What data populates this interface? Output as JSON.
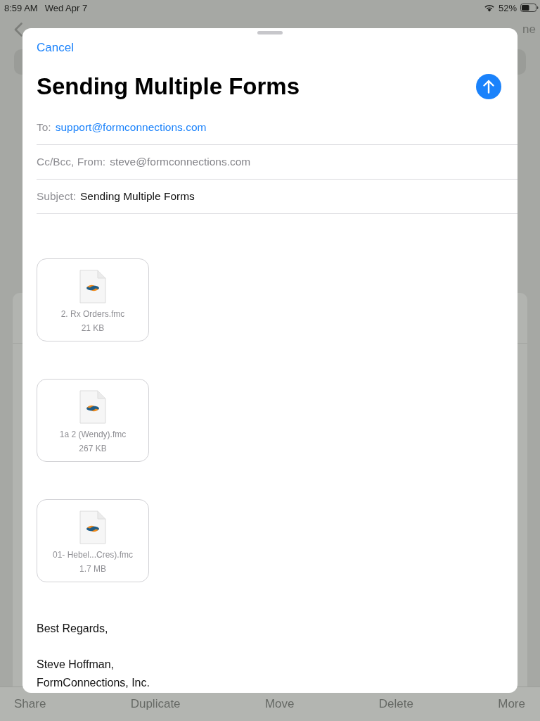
{
  "status_bar": {
    "time": "8:59 AM",
    "date": "Wed Apr 7",
    "battery_percent": "52%"
  },
  "nav_bar": {
    "trailing_button": "ne"
  },
  "compose": {
    "cancel": "Cancel",
    "title": "Sending Multiple Forms",
    "fields": [
      {
        "kind": "recipient",
        "label": "To:",
        "value": "support@formconnections.com"
      },
      {
        "kind": "sender",
        "label": "Cc/Bcc, From:",
        "value": "steve@formconnections.com"
      },
      {
        "kind": "subject",
        "label": "Subject:",
        "value": "Sending Multiple Forms"
      }
    ],
    "attachments": [
      {
        "name": "2. Rx Orders.fmc",
        "size": "21 KB"
      },
      {
        "name": "1a 2 (Wendy).fmc",
        "size": "267 KB"
      },
      {
        "name": "01- Hebel...Cres).fmc",
        "size": "1.7 MB"
      }
    ],
    "signature": {
      "closing": "Best Regards,",
      "lines": [
        "Steve Hoffman,",
        "FormConnections, Inc."
      ]
    }
  },
  "toolbar": {
    "actions": [
      "Share",
      "Duplicate",
      "Move",
      "Delete",
      "More"
    ]
  }
}
